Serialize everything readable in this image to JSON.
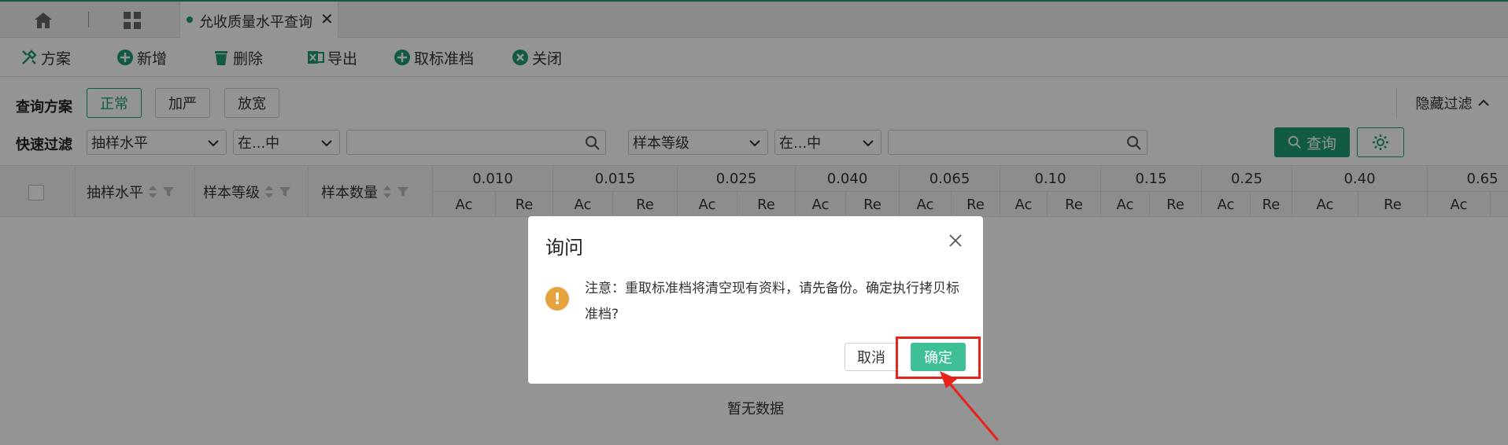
{
  "tabs": {
    "active_title": "允收质量水平查询",
    "close_glyph": "✕"
  },
  "toolbar": {
    "items": [
      {
        "label": "方案",
        "icon": "wrench-icon"
      },
      {
        "label": "新增",
        "icon": "plus-circle-icon"
      },
      {
        "label": "删除",
        "icon": "trash-icon"
      },
      {
        "label": "导出",
        "icon": "excel-icon"
      },
      {
        "label": "取标准档",
        "icon": "plus-circle-icon"
      },
      {
        "label": "关闭",
        "icon": "close-circle-icon"
      }
    ]
  },
  "filter": {
    "scheme_label": "查询方案",
    "schemes": [
      "正常",
      "加严",
      "放宽"
    ],
    "active_scheme": "正常",
    "hide_label": "隐藏过滤",
    "quick_label": "快速过滤",
    "field1": "抽样水平",
    "op1": "在...中",
    "value1": "",
    "field2": "样本等级",
    "op2": "在...中",
    "value2": "",
    "query_label": "查询"
  },
  "table": {
    "columns": [
      {
        "label": "抽样水平",
        "sortable": true,
        "filterable": true
      },
      {
        "label": "样本等级",
        "sortable": true,
        "filterable": true
      },
      {
        "label": "样本数量",
        "sortable": true,
        "filterable": true
      }
    ],
    "aql_levels": [
      "0.010",
      "0.015",
      "0.025",
      "0.040",
      "0.065",
      "0.10",
      "0.15",
      "0.25",
      "0.40",
      "0.65"
    ],
    "sub_ac": "Ac",
    "sub_re": "Re",
    "empty_text": "暂无数据"
  },
  "dialog": {
    "title": "询问",
    "message": "注意：重取标准档将清空现有资料，请先备份。确定执行拷贝标准档?",
    "cancel_label": "取消",
    "ok_label": "确定"
  },
  "colors": {
    "accent": "#1e9b77",
    "ok_button": "#3fbf97",
    "warning": "#e6a23c",
    "annotation": "#e8231b"
  }
}
